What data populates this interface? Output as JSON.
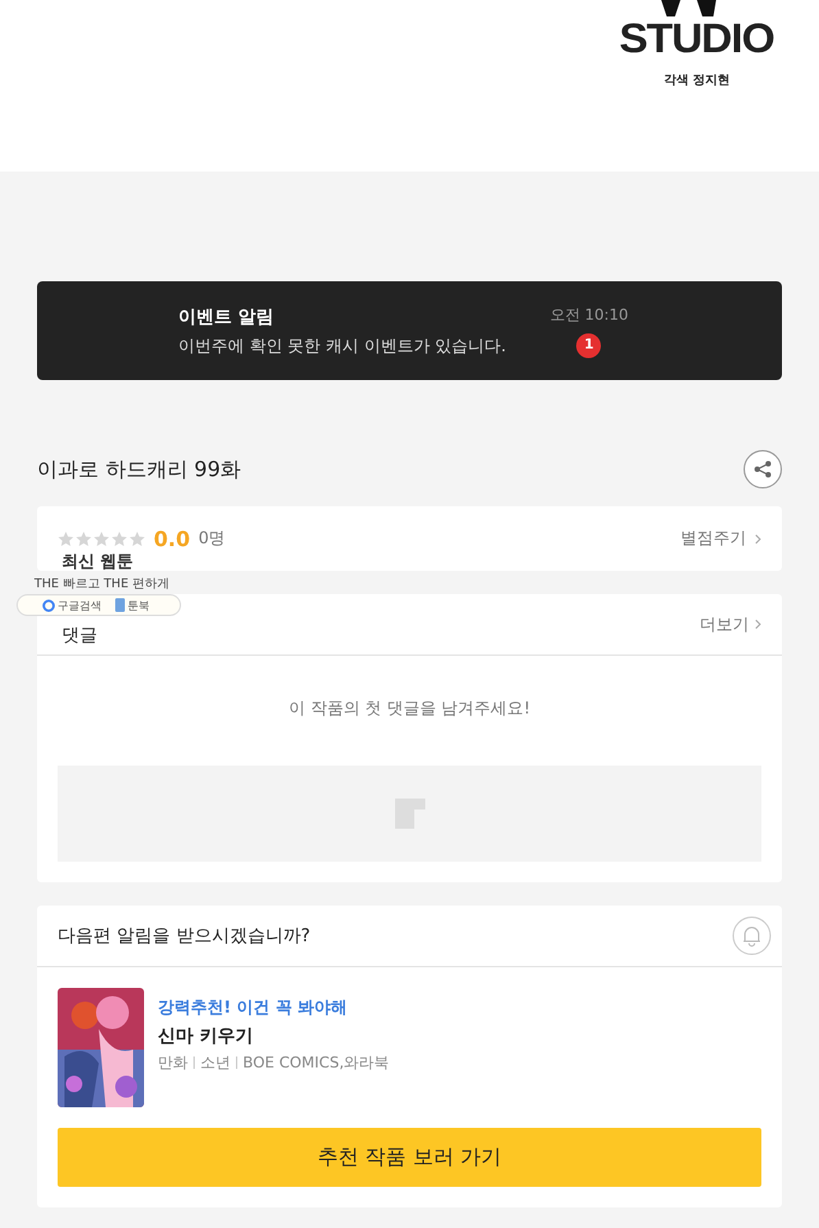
{
  "header": {
    "logo_text": "STUDIO",
    "credit": "각색 정지현"
  },
  "notification": {
    "title": "이벤트 알림",
    "message": "이번주에 확인 못한 캐시 이벤트가 있습니다.",
    "time": "오전 10:10",
    "badge": "1"
  },
  "episode": {
    "title": "이과로 하드캐리 99화"
  },
  "rating": {
    "stars": 0,
    "score": "0.0",
    "count": "0명",
    "action": "별점주기"
  },
  "comments": {
    "title": "댓글",
    "more": "더보기",
    "empty_message": "이 작품의 첫 댓글을 남겨주세요!"
  },
  "floating_widget": {
    "title": "최신 웹툰",
    "tagline": "THE 빠르고 THE 편하게",
    "links": [
      "구글검색",
      "툰북"
    ]
  },
  "subscribe": {
    "question": "다음편 알림을 받으시겠습니까?",
    "on": false
  },
  "recommendation": {
    "tag": "강력추천! 이건 꼭 봐야해",
    "title": "신마 키우기",
    "meta": [
      "만화",
      "소년",
      "BOE COMICS,와라북"
    ]
  },
  "button": "추천 작품 보러 가기"
}
